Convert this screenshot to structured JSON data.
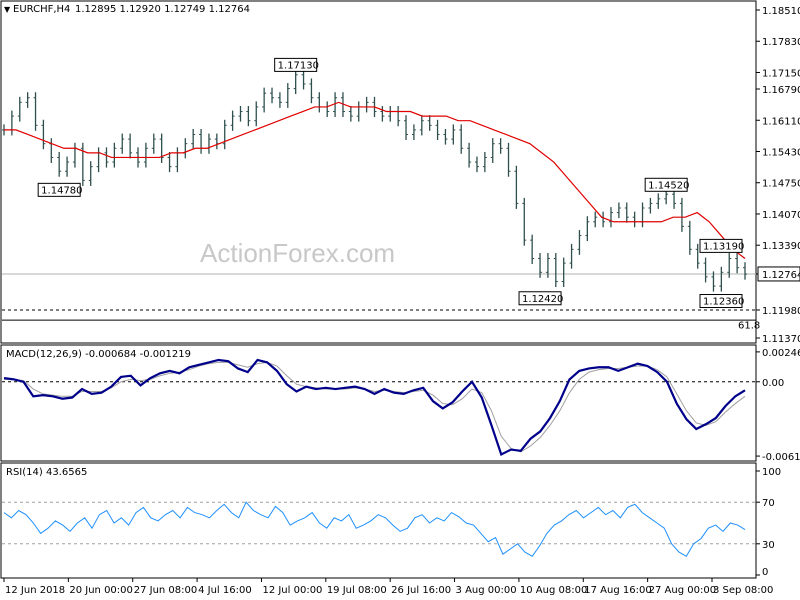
{
  "header": {
    "symbol_timeframe": "EURCHF,H4",
    "ohlc": "1.12895 1.12920 1.12749 1.12764"
  },
  "watermark": "ActionForex.com",
  "colors": {
    "bars": "#2f4f4f",
    "ma": "#e00000",
    "macd": "#00008b",
    "signal": "#a0a0a0",
    "rsi": "#1e90ff",
    "grid": "#808080"
  },
  "chart_data": [
    {
      "type": "ohlc_bar",
      "title": "EURCHF,H4",
      "ylim": [
        1.1137,
        1.1851
      ],
      "y_ticks": [
        "1.18510",
        "1.17830",
        "1.17150",
        "1.16790",
        "1.16110",
        "1.15430",
        "1.14750",
        "1.14070",
        "1.13390",
        "1.12764",
        "1.11980",
        "1.11370"
      ],
      "x_ticks": [
        "12 Jun 2018",
        "20 Jun 00:00",
        "27 Jun 08:00",
        "4 Jul 16:00",
        "12 Jul 00:00",
        "19 Jul 08:00",
        "26 Jul 16:00",
        "3 Aug 00:00",
        "10 Aug 08:00",
        "17 Aug 16:00",
        "27 Aug 00:00",
        "3 Sep 08:00"
      ],
      "current_price": "1.12764",
      "horizontal_line": {
        "value": 1.1198,
        "label": "1.11980"
      },
      "fib_label": "61.8",
      "annotations": [
        {
          "label": "1.14780",
          "value": 1.1478
        },
        {
          "label": "1.17130",
          "value": 1.1713
        },
        {
          "label": "1.12420",
          "value": 1.1242
        },
        {
          "label": "1.14520",
          "value": 1.1452
        },
        {
          "label": "1.13190",
          "value": 1.1319
        },
        {
          "label": "1.12360",
          "value": 1.1236
        }
      ],
      "series": [
        {
          "kind": "close",
          "values": [
            1.159,
            1.162,
            1.165,
            1.166,
            1.16,
            1.156,
            1.153,
            1.15,
            1.152,
            1.155,
            1.148,
            1.151,
            1.154,
            1.152,
            1.155,
            1.157,
            1.154,
            1.152,
            1.155,
            1.157,
            1.153,
            1.151,
            1.154,
            1.156,
            1.158,
            1.155,
            1.157,
            1.156,
            1.16,
            1.162,
            1.163,
            1.161,
            1.164,
            1.167,
            1.166,
            1.165,
            1.168,
            1.171,
            1.169,
            1.166,
            1.164,
            1.163,
            1.166,
            1.163,
            1.162,
            1.164,
            1.165,
            1.163,
            1.162,
            1.163,
            1.161,
            1.158,
            1.159,
            1.161,
            1.16,
            1.158,
            1.157,
            1.159,
            1.155,
            1.152,
            1.151,
            1.153,
            1.156,
            1.155,
            1.15,
            1.143,
            1.135,
            1.131,
            1.128,
            1.131,
            1.126,
            1.13,
            1.133,
            1.136,
            1.139,
            1.14,
            1.139,
            1.141,
            1.142,
            1.14,
            1.139,
            1.142,
            1.143,
            1.144,
            1.145,
            1.143,
            1.138,
            1.133,
            1.13,
            1.127,
            1.125,
            1.128,
            1.131,
            1.129,
            1.1276
          ]
        },
        {
          "kind": "moving_average",
          "values": [
            1.159,
            1.159,
            1.158,
            1.157,
            1.156,
            1.155,
            1.155,
            1.154,
            1.154,
            1.153,
            1.153,
            1.153,
            1.153,
            1.153,
            1.154,
            1.154,
            1.155,
            1.155,
            1.156,
            1.157,
            1.158,
            1.159,
            1.16,
            1.161,
            1.162,
            1.163,
            1.164,
            1.164,
            1.165,
            1.164,
            1.164,
            1.164,
            1.163,
            1.163,
            1.163,
            1.162,
            1.162,
            1.162,
            1.161,
            1.161,
            1.16,
            1.159,
            1.158,
            1.157,
            1.156,
            1.154,
            1.152,
            1.149,
            1.146,
            1.143,
            1.14,
            1.139,
            1.139,
            1.139,
            1.139,
            1.139,
            1.14,
            1.14,
            1.141,
            1.139,
            1.136,
            1.133,
            1.131
          ]
        }
      ]
    },
    {
      "type": "line",
      "title": "MACD(12,26,9) -0.000684 -0.001219",
      "ylim": [
        -0.00613,
        0.00246
      ],
      "y_ticks": [
        "0.002469",
        "0.00",
        "-0.006136"
      ],
      "series": [
        {
          "name": "MACD",
          "values": [
            0.0003,
            0.0002,
            0.0,
            -0.0012,
            -0.0011,
            -0.0012,
            -0.0014,
            -0.0013,
            -0.0006,
            -0.001,
            -0.0009,
            -0.0004,
            0.0004,
            0.0005,
            -0.0003,
            0.0003,
            0.0007,
            0.0009,
            0.0007,
            0.0012,
            0.0014,
            0.0016,
            0.0018,
            0.0017,
            0.0011,
            0.0008,
            0.0018,
            0.0016,
            0.0009,
            -0.0002,
            -0.0008,
            -0.0004,
            -0.0006,
            -0.0005,
            -0.0006,
            -0.0005,
            -0.0004,
            -0.0006,
            -0.001,
            -0.0006,
            -0.0009,
            -0.001,
            -0.0007,
            -0.0005,
            -0.0016,
            -0.0022,
            -0.0017,
            -0.0008,
            0.0,
            -0.0013,
            -0.0036,
            -0.006,
            -0.0056,
            -0.0057,
            -0.0047,
            -0.0041,
            -0.003,
            -0.0016,
            0.0002,
            0.0009,
            0.0011,
            0.0012,
            0.0012,
            0.0009,
            0.0012,
            0.0015,
            0.0013,
            0.0008,
            0.0,
            -0.0018,
            -0.0031,
            -0.0039,
            -0.0035,
            -0.003,
            -0.002,
            -0.0012,
            -0.0007
          ]
        },
        {
          "name": "Signal",
          "values": [
            0.0002,
            0.0002,
            0.0001,
            -0.0006,
            -0.001,
            -0.0011,
            -0.0012,
            -0.0012,
            -0.0008,
            -0.0008,
            -0.0008,
            -0.0005,
            0.0,
            0.0002,
            0.0001,
            0.0002,
            0.0005,
            0.0007,
            0.0008,
            0.001,
            0.0013,
            0.0015,
            0.0016,
            0.0016,
            0.0014,
            0.0012,
            0.0015,
            0.0016,
            0.0013,
            0.0005,
            -0.0002,
            -0.0004,
            -0.0005,
            -0.0006,
            -0.0006,
            -0.0006,
            -0.0005,
            -0.0006,
            -0.0008,
            -0.0007,
            -0.0008,
            -0.0009,
            -0.0008,
            -0.0007,
            -0.0011,
            -0.0018,
            -0.0019,
            -0.0014,
            -0.0006,
            -0.0009,
            -0.0024,
            -0.0045,
            -0.0055,
            -0.0058,
            -0.0053,
            -0.0046,
            -0.0036,
            -0.0024,
            -0.0009,
            0.0002,
            0.0008,
            0.001,
            0.0011,
            0.0011,
            0.0012,
            0.0013,
            0.0013,
            0.001,
            0.0004,
            -0.001,
            -0.0024,
            -0.0034,
            -0.0036,
            -0.0033,
            -0.0025,
            -0.0018,
            -0.0012
          ]
        }
      ]
    },
    {
      "type": "line",
      "title": "RSI(14) 43.6565",
      "ylim": [
        0,
        100
      ],
      "y_ticks": [
        "100",
        "70",
        "30",
        "0"
      ],
      "levels": [
        70,
        30
      ],
      "series": [
        {
          "name": "RSI",
          "values": [
            60,
            55,
            62,
            58,
            50,
            40,
            45,
            52,
            48,
            42,
            50,
            55,
            45,
            58,
            62,
            50,
            55,
            48,
            60,
            65,
            55,
            52,
            58,
            62,
            55,
            65,
            60,
            58,
            55,
            62,
            68,
            60,
            55,
            70,
            62,
            58,
            55,
            66,
            60,
            48,
            52,
            55,
            60,
            50,
            45,
            55,
            52,
            58,
            45,
            48,
            52,
            58,
            55,
            48,
            42,
            45,
            55,
            58,
            50,
            55,
            52,
            60,
            56,
            50,
            48,
            40,
            32,
            36,
            20,
            25,
            30,
            22,
            18,
            28,
            40,
            48,
            52,
            58,
            62,
            55,
            60,
            65,
            58,
            62,
            55,
            65,
            68,
            60,
            55,
            50,
            45,
            30,
            22,
            18,
            30,
            35,
            45,
            48,
            42,
            50,
            48,
            43.66
          ]
        }
      ]
    }
  ]
}
